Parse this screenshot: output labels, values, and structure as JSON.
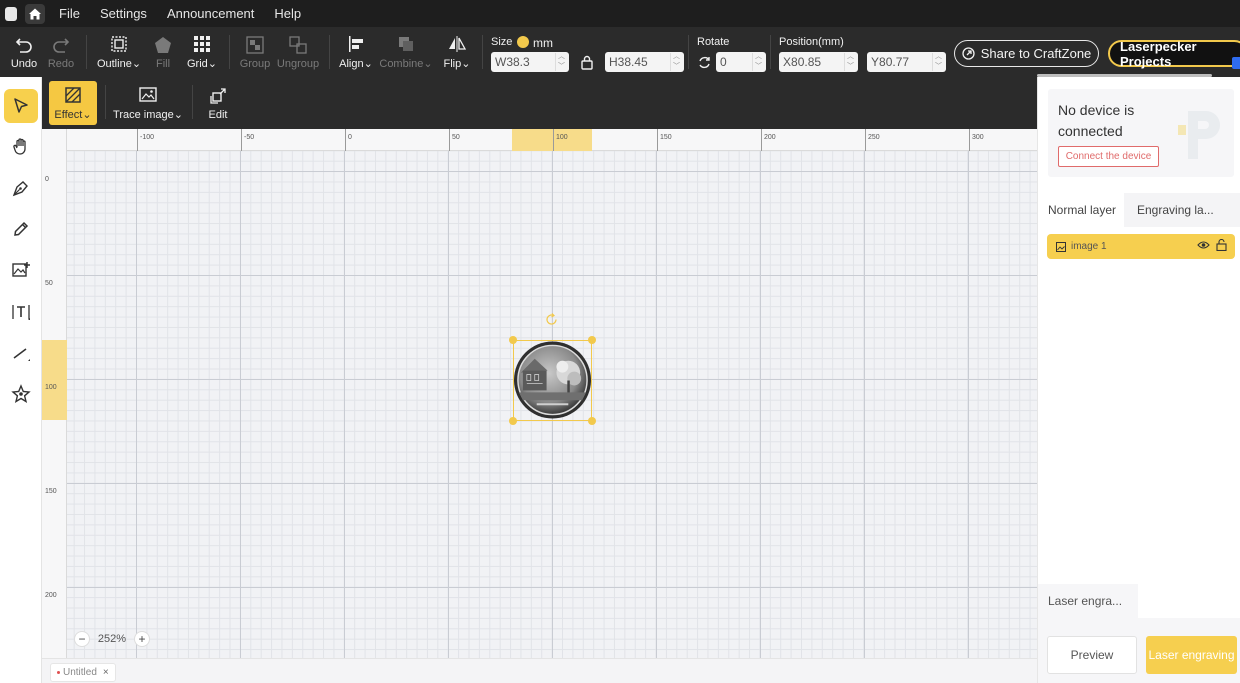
{
  "menu": {
    "items": [
      "File",
      "Settings",
      "Announcement",
      "Help"
    ]
  },
  "toolbar": {
    "undo": "Undo",
    "redo": "Redo",
    "outline": "Outline",
    "fill": "Fill",
    "grid": "Grid",
    "group": "Group",
    "ungroup": "Ungroup",
    "align": "Align",
    "combine": "Combine",
    "flip": "Flip",
    "size_label": "Size",
    "unit": "mm",
    "width": "38.3",
    "height": "38.45",
    "w_prefix": "W",
    "h_prefix": "H",
    "rotate_label": "Rotate",
    "rotate_value": "0",
    "position_label": "Position(mm)",
    "x_prefix": "X",
    "y_prefix": "Y",
    "x": "80.85",
    "y": "80.77",
    "share": "Share to CraftZone",
    "projects": "Laserpecker Projects"
  },
  "subtoolbar": {
    "effect": "Effect",
    "trace": "Trace image",
    "edit": "Edit"
  },
  "ruler": {
    "top": [
      "-100",
      "-50",
      "0",
      "50",
      "100",
      "150",
      "200",
      "250",
      "300"
    ],
    "left": [
      "0",
      "50",
      "100",
      "150",
      "200"
    ]
  },
  "canvas": {
    "zoom": "252%",
    "zoom_minus": "−",
    "zoom_plus": "+"
  },
  "doc_tab": {
    "name": "Untitled",
    "close": "×"
  },
  "device": {
    "status": "No device is connected",
    "connect": "Connect the device"
  },
  "layers": {
    "tab_normal": "Normal layer",
    "tab_engraving": "Engraving la...",
    "items": [
      {
        "name": "image 1"
      }
    ]
  },
  "laser": {
    "tab": "Laser engra...",
    "preview": "Preview",
    "engrave": "Laser engraving"
  },
  "colors": {
    "accent": "#f6cf4f",
    "dark": "#2b2b2b",
    "connect": "#e06b6b"
  }
}
